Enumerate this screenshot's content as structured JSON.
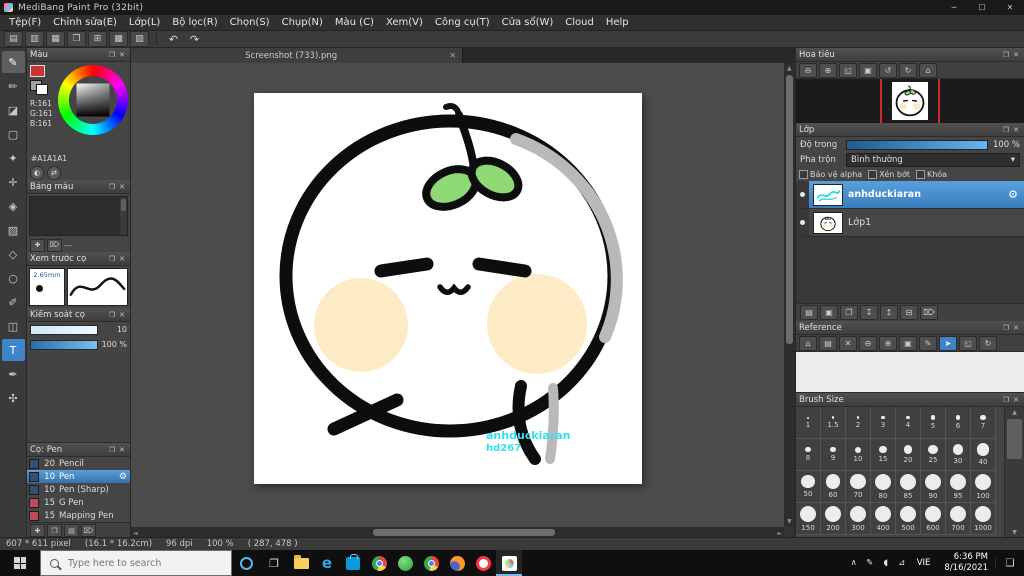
{
  "ui": {
    "popout": "❐",
    "close": "✕",
    "gear": "⚙",
    "dropdown_arrow": "▾",
    "divider_text": "---"
  },
  "colors": {
    "accent_blue": "#3d85c8",
    "selected_layer_blue": "#4a92d6",
    "slider_blue": "#66b5ef",
    "leaf_green": "#8fd974",
    "blush_cream": "#fcebc4",
    "watermark_cyan": "#35e0ea",
    "shadow_gray": "#b9b9b9",
    "navigator_guide_red": "#cc2b2b",
    "current_color_hex": "#A1A1A1"
  },
  "titlebar": {
    "title": "MediBang Paint Pro (32bit)",
    "minimize": "─",
    "maximize": "☐",
    "close": "✕"
  },
  "menubar": {
    "items": [
      "Tệp(F)",
      "Chỉnh sửa(E)",
      "Lớp(L)",
      "Bộ lọc(R)",
      "Chọn(S)",
      "Chụp(N)",
      "Màu (C)",
      "Xem(V)",
      "Công cụ(T)",
      "Cửa sổ(W)",
      "Cloud",
      "Help"
    ]
  },
  "toolbar": {
    "buttons": [
      {
        "base": "new-file",
        "glyph": "▤"
      },
      {
        "base": "open-file",
        "glyph": "▥"
      },
      {
        "base": "save",
        "glyph": "▦"
      },
      {
        "base": "export",
        "glyph": "❐"
      },
      {
        "base": "canvas-settings",
        "glyph": "⊞"
      },
      {
        "base": "grid-toggle",
        "glyph": "▩"
      },
      {
        "base": "material",
        "glyph": "▨"
      }
    ],
    "history_buttons": [
      {
        "base": "undo",
        "glyph": "↶"
      },
      {
        "base": "redo",
        "glyph": "↷"
      }
    ]
  },
  "tools": [
    {
      "base": "brush-tool",
      "glyph": "✎",
      "active": true
    },
    {
      "base": "pencil-tool",
      "glyph": "✏"
    },
    {
      "base": "eraser-tool",
      "glyph": "◪"
    },
    {
      "base": "marquee-tool",
      "glyph": "▢"
    },
    {
      "base": "magic-wand-tool",
      "glyph": "✦"
    },
    {
      "base": "move-tool",
      "glyph": "✛"
    },
    {
      "base": "fill-tool",
      "glyph": "◈"
    },
    {
      "base": "gradient-tool",
      "glyph": "▨"
    },
    {
      "base": "shape-tool",
      "glyph": "◇"
    },
    {
      "base": "lasso-tool",
      "glyph": "○"
    },
    {
      "base": "select-pen-tool",
      "glyph": "✐"
    },
    {
      "base": "slice-tool",
      "glyph": "◫"
    },
    {
      "base": "text-tool",
      "glyph": "T",
      "highlight": true
    },
    {
      "base": "eyedropper-tool",
      "glyph": "✒"
    },
    {
      "base": "hand-tool",
      "glyph": "✣"
    }
  ],
  "left": {
    "color_panel": {
      "title": "Màu",
      "r": "R:161",
      "g": "G:161",
      "b": "B:161",
      "hex": "#A1A1A1"
    },
    "palette_panel": {
      "title": "Bảng màu",
      "footer_text": "---",
      "footer_icons": [
        {
          "base": "add-swatch",
          "glyph": "✚"
        },
        {
          "base": "delete-swatch",
          "glyph": "⌦"
        }
      ]
    },
    "preview_panel": {
      "title": "Xem trước cọ",
      "size_label": "2.65mm"
    },
    "control_panel": {
      "title": "Kiểm soát cọ",
      "size_value": "10",
      "opacity_value": "100 %"
    },
    "brush_panel": {
      "title": "Cọ: Pen",
      "brushes": [
        {
          "size": "20",
          "name": "Pencil",
          "selected": false,
          "color": "#33506e"
        },
        {
          "size": "10",
          "name": "Pen",
          "selected": true,
          "color": "#33506e"
        },
        {
          "size": "10",
          "name": "Pen (Sharp)",
          "selected": false,
          "color": "#33506e"
        },
        {
          "size": "15",
          "name": "G Pen",
          "selected": false,
          "color": "#c2485e"
        },
        {
          "size": "15",
          "name": "Mapping Pen",
          "selected": false,
          "color": "#c2485e"
        }
      ],
      "footer_icons": [
        {
          "base": "add-brush",
          "glyph": "✚"
        },
        {
          "base": "duplicate-brush",
          "glyph": "❐"
        },
        {
          "base": "brush-menu",
          "glyph": "▤"
        },
        {
          "base": "delete-brush",
          "glyph": "⌦"
        }
      ]
    }
  },
  "canvas": {
    "tab": "Screenshot (733).png",
    "watermark_line1": "anhduckiaran",
    "watermark_line2": "hd267"
  },
  "right": {
    "navigator": {
      "title": "Hoa tiêu",
      "icons": [
        {
          "base": "nav-zoom-out",
          "glyph": "⊖"
        },
        {
          "base": "nav-zoom-in",
          "glyph": "⊕"
        },
        {
          "base": "nav-fit",
          "glyph": "◱"
        },
        {
          "base": "nav-actual-size",
          "glyph": "▣"
        },
        {
          "base": "nav-rotate-left",
          "glyph": "↺"
        },
        {
          "base": "nav-rotate-right",
          "glyph": "↻"
        },
        {
          "base": "nav-reset",
          "glyph": "⌂"
        }
      ]
    },
    "layers": {
      "title": "Lớp",
      "opacity_label": "Độ trong",
      "opacity_value": "100 %",
      "blend_label": "Pha trộn",
      "blend_value": "Bình thường",
      "check_alpha": "Bảo vệ alpha",
      "check_clip": "Xén bớt",
      "check_lock": "Khóa",
      "items": [
        {
          "name": "anhduckiaran",
          "selected": true
        },
        {
          "name": "Lớp1",
          "selected": false
        }
      ],
      "toolbar_icons": [
        {
          "base": "add-layer",
          "glyph": "▤"
        },
        {
          "base": "add-layer-folder",
          "glyph": "▣"
        },
        {
          "base": "duplicate-layer",
          "glyph": "❐"
        },
        {
          "base": "merge-layer-down",
          "glyph": "↧"
        },
        {
          "base": "raise-layer",
          "glyph": "↥"
        },
        {
          "base": "layer-settings",
          "glyph": "⊟"
        },
        {
          "base": "delete-layer",
          "glyph": "⌦"
        }
      ]
    },
    "reference": {
      "title": "Reference",
      "icons": [
        {
          "base": "ref-home",
          "glyph": "⌂"
        },
        {
          "base": "ref-open",
          "glyph": "▤"
        },
        {
          "base": "ref-close",
          "glyph": "✕"
        },
        {
          "base": "ref-zoom-out",
          "glyph": "⊖"
        },
        {
          "base": "ref-zoom-in",
          "glyph": "⊕"
        },
        {
          "base": "ref-actual-size",
          "glyph": "▣"
        },
        {
          "base": "ref-pen",
          "glyph": "✎"
        },
        {
          "base": "ref-picker",
          "glyph": "➤",
          "highlight": true
        },
        {
          "base": "ref-crop",
          "glyph": "◱"
        },
        {
          "base": "ref-rotate",
          "glyph": "↻"
        }
      ]
    },
    "brush_size": {
      "title": "Brush Size",
      "sizes": [
        1,
        1.5,
        2,
        3,
        4,
        5,
        6,
        7,
        8,
        9,
        10,
        15,
        20,
        25,
        30,
        40,
        50,
        60,
        70,
        80,
        85,
        90,
        95,
        100,
        150,
        200,
        300,
        400,
        500,
        600,
        700,
        1000
      ]
    }
  },
  "statusbar": {
    "size": "607 * 611 pixel",
    "cm": "(16.1 * 16.2cm)",
    "dpi": "96 dpi",
    "zoom": "100 %",
    "coords": "( 287, 478 )"
  },
  "taskbar": {
    "search_placeholder": "Type here to search",
    "taskview_glyph": "❐",
    "apps": [
      {
        "name": "file-explorer-icon",
        "cls": "ic-folder"
      },
      {
        "name": "edge-icon",
        "cls": "ic-edge",
        "glyph": "e"
      },
      {
        "name": "store-icon",
        "cls": "ic-store"
      },
      {
        "name": "chrome-icon",
        "cls": "ic-chrome"
      },
      {
        "name": "green-app-icon",
        "cls": "ic-green"
      },
      {
        "name": "chrome-icon-2",
        "cls": "ic-chrome"
      },
      {
        "name": "firefox-icon",
        "cls": "ic-firefox"
      },
      {
        "name": "opera-icon",
        "cls": "ic-opera"
      },
      {
        "name": "medibang-icon",
        "cls": "ic-medibang",
        "active": true
      }
    ],
    "tray_icons": [
      {
        "base": "tray-expand",
        "glyph": "∧"
      },
      {
        "base": "tray-pen",
        "glyph": "✎"
      },
      {
        "base": "tray-volume",
        "glyph": "◖"
      },
      {
        "base": "tray-network",
        "glyph": "⊿"
      }
    ],
    "lang": "VIE",
    "time": "6:36 PM",
    "date": "8/16/2021",
    "action_center_glyph": "❏"
  }
}
